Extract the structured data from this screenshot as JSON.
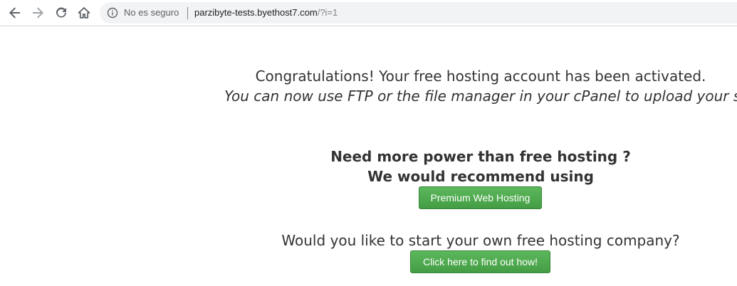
{
  "browser": {
    "security_label": "No es seguro",
    "url_host": "parzibyte-tests.byethost7.com",
    "url_path": "/?i=1",
    "icons": [
      "back-arrow-icon",
      "forward-arrow-icon",
      "reload-icon",
      "home-icon",
      "info-icon"
    ]
  },
  "page": {
    "congrats": "Congratulations! Your free hosting account has been activated.",
    "congrats_sub": "You can now use FTP or the file manager in your cPanel to upload your site.",
    "power": "Need more power than free hosting ?",
    "recommend": "We would recommend using",
    "premium_button": "Premium Web Hosting",
    "question": "Would you like to start your own free hosting company?",
    "findout_button": "Click here to find out how!"
  },
  "colors": {
    "button_green": "#5cb85c",
    "text": "#333333",
    "omnibox_bg": "#f1f3f4"
  }
}
